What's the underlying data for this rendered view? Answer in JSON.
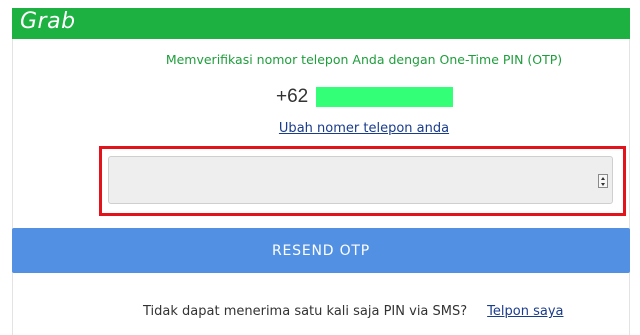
{
  "header": {
    "logo_text": "Grab",
    "background_color": "#1db142"
  },
  "verification": {
    "message": "Memverifikasi nomor telepon Anda dengan One-Time PIN (OTP)",
    "phone_prefix": "+62",
    "change_phone_link": "Ubah nomer telepon anda"
  },
  "otp_input": {
    "value": "",
    "placeholder": "",
    "type": "number"
  },
  "resend_button": {
    "label": "RESEND OTP",
    "color": "#5190e3"
  },
  "footer": {
    "question": "Tidak dapat menerima satu kali saja PIN via SMS?",
    "call_link": "Telpon saya"
  },
  "colors": {
    "highlight": "#e3131c",
    "phone_mask": "#33ff77",
    "accent_text": "#1f9e3c",
    "link": "#1a3c8c"
  }
}
